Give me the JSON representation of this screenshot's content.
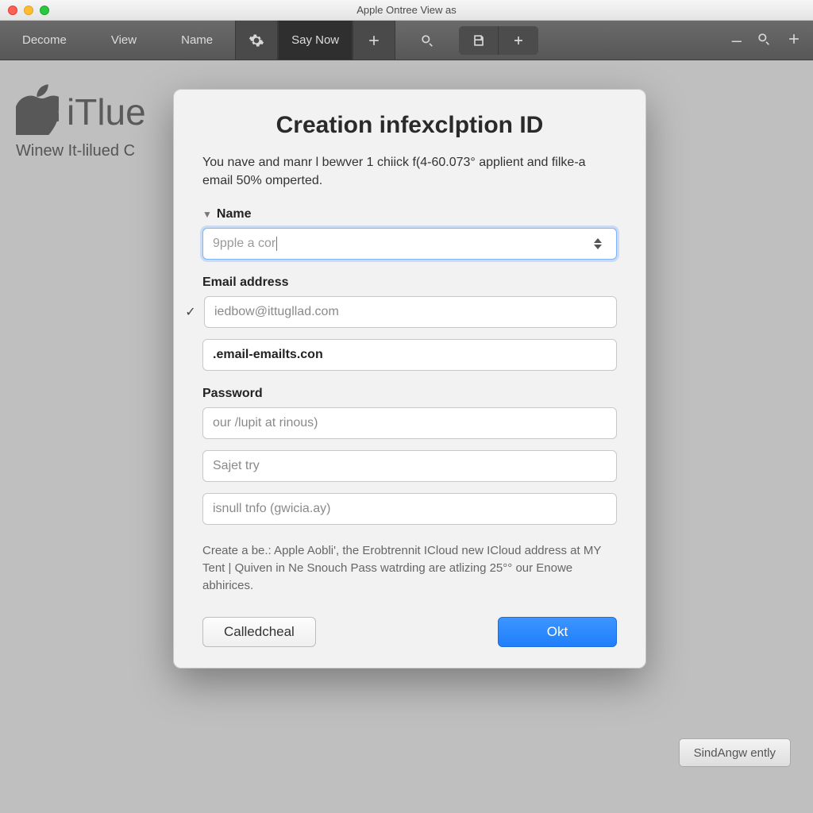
{
  "window": {
    "title": "Apple Ontree View as"
  },
  "toolbar": {
    "items": [
      "Decome",
      "View",
      "Name"
    ],
    "active_tab": "Say Now"
  },
  "background": {
    "logo_text": "iTlue",
    "subtitle": "Winew It-lilued C"
  },
  "modal": {
    "title": "Creation infexclption ID",
    "intro": "You nave and manr l bewver 1 chiick f(4-60.073° applient and filke-a email 50% omperted.",
    "name_label": "Name",
    "name_value": "9pple a cor",
    "email_label": "Email address",
    "email_value": "iedbow@ittugllad.com",
    "domain_value": ".email-emailts.con",
    "password_label": "Password",
    "password_placeholder": "our /lupit at rinous)",
    "extra1_placeholder": "Sajet try",
    "extra2_placeholder": "isnull tnfo (gwicia.ay)",
    "footnote": "Create a be.: Apple Aobli', the Erobtrennit ICloud new ICloud address at MY Tent | Quiven in Ne Snouch Pass watrding are atlizing 25°° our Enowe abhirices.",
    "cancel_label": "Calledcheal",
    "ok_label": "Okt"
  },
  "float_button": "SindAngw ently"
}
